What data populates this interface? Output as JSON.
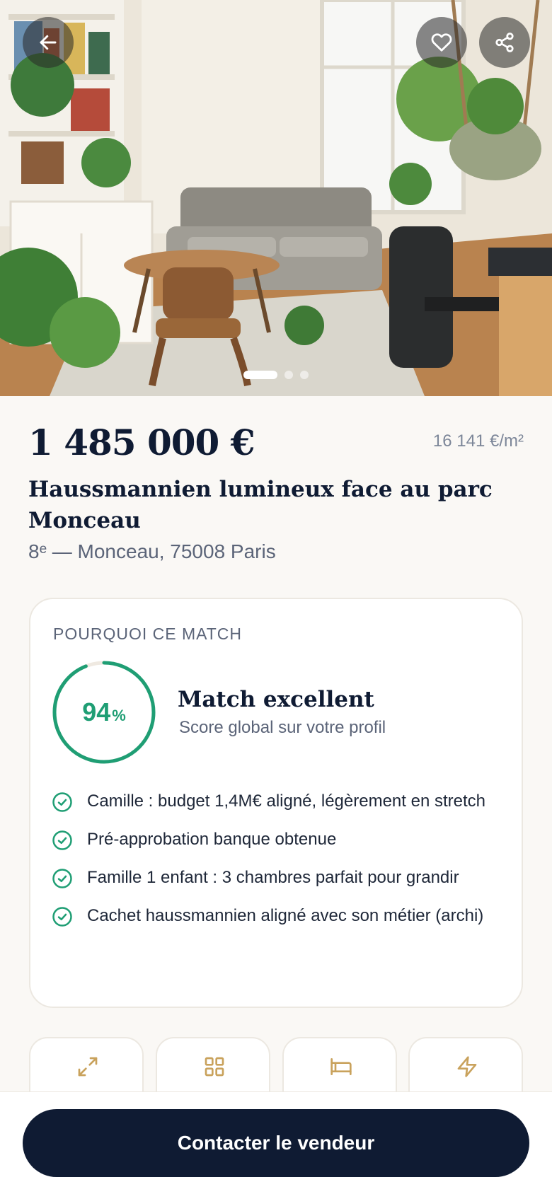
{
  "listing": {
    "price": "1 485 000 €",
    "price_per_m2": "16 141 €/m²",
    "title": "Haussmannien lumineux face au parc Monceau",
    "address": "8ᵉ — Monceau, 75008 Paris"
  },
  "gallery": {
    "photo_count": 3,
    "active_index": 0
  },
  "match": {
    "kicker": "POURQUOI CE MATCH",
    "score": "94",
    "score_unit": "%",
    "score_value": 94,
    "label": "Match excellent",
    "sublabel": "Score global sur votre profil",
    "reasons": [
      "Camille : budget 1,4M€ aligné, légèrement en stretch",
      "Pré-approbation banque obtenue",
      "Famille 1 enfant : 3 chambres parfait pour grandir",
      "Cachet haussmannien aligné avec son métier (archi)"
    ]
  },
  "tiles": [
    {
      "icon": "expand-arrows-icon"
    },
    {
      "icon": "grid-rooms-icon"
    },
    {
      "icon": "bed-icon"
    },
    {
      "icon": "lightning-energy-icon"
    }
  ],
  "cta": {
    "label": "Contacter le vendeur"
  },
  "colors": {
    "navy": "#0f1b33",
    "match_green": "#1f9e74",
    "gold_icon": "#c9a25c",
    "background": "#faf8f5"
  }
}
